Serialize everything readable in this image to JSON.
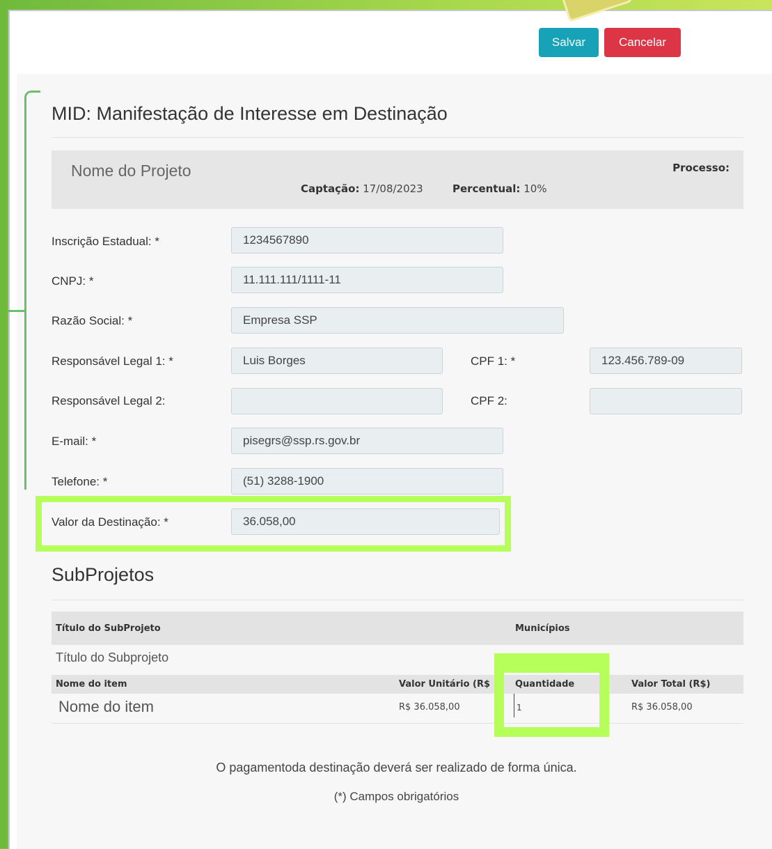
{
  "toolbar": {
    "save_label": "Salvar",
    "cancel_label": "Cancelar"
  },
  "form": {
    "title": "MID: Manifestação de Interesse em Destinação",
    "project": {
      "name": "Nome do Projeto",
      "processo_label": "Processo:",
      "captacao_label": "Captação:",
      "captacao_value": "17/08/2023",
      "percentual_label": "Percentual:",
      "percentual_value": "10%"
    },
    "fields": {
      "inscricao": {
        "label": "Inscrição Estadual: *",
        "value": "1234567890"
      },
      "cnpj": {
        "label": "CNPJ: *",
        "value": "11.111.111/1111-11"
      },
      "razao": {
        "label": "Razão Social: *",
        "value": "Empresa SSP"
      },
      "resp1": {
        "label": "Responsável Legal 1: *",
        "value": "Luis Borges"
      },
      "cpf1": {
        "label": "CPF 1: *",
        "value": "123.456.789-09"
      },
      "resp2": {
        "label": "Responsável Legal 2:",
        "value": ""
      },
      "cpf2": {
        "label": "CPF 2:",
        "value": ""
      },
      "email": {
        "label": "E-mail: *",
        "value": "pisegrs@ssp.rs.gov.br"
      },
      "telefone": {
        "label": "Telefone: *",
        "value": "(51) 3288-1900"
      },
      "valor": {
        "label": "Valor da Destinação: *",
        "value": "36.058,00"
      }
    }
  },
  "subprojetos": {
    "title": "SubProjetos",
    "headers": {
      "titulo": "Título do SubProjeto",
      "municipios": "Municípios"
    },
    "subproject_title": "Título do Subprojeto",
    "item_headers": {
      "nome": "Nome do item",
      "valor_unit": "Valor Unitário (R$",
      "quantidade": "Quantidade",
      "valor_total": "Valor Total (R$)"
    },
    "item": {
      "nome": "Nome do item",
      "valor_unit": "R$ 36.058,00",
      "quantidade": "1",
      "valor_total": "R$ 36.058,00"
    }
  },
  "footer": {
    "pagamento_note": "O pagamentoda destinação deverá ser realizado de forma única.",
    "required_note": "(*) Campos obrigatórios"
  },
  "colors": {
    "accent_save": "#17a2b8",
    "accent_cancel": "#dc3545",
    "highlight": "#b6ff5a",
    "bracket": "#6abf69"
  }
}
